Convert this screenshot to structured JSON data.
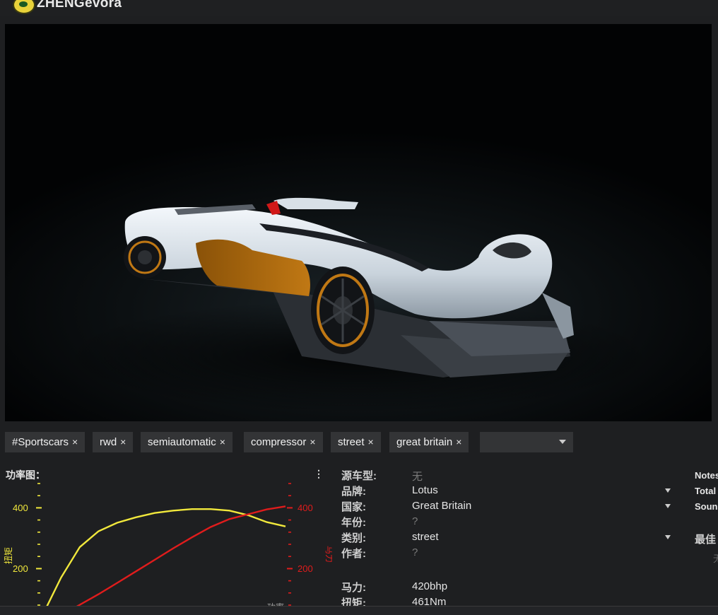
{
  "window": {
    "title": "ZHENGevora",
    "logo_icon": "lotus-logo-icon"
  },
  "tags": [
    {
      "label": "#Sportscars"
    },
    {
      "label": "rwd"
    },
    {
      "label": "semiautomatic"
    },
    {
      "label": "compressor"
    },
    {
      "label": "street"
    },
    {
      "label": "great britain"
    }
  ],
  "tag_remove_symbol": "×",
  "chart": {
    "title": "功率图：",
    "menu_icon": "⋮"
  },
  "chart_data": {
    "type": "line",
    "left_axis": {
      "ticks": [
        "400",
        "200"
      ],
      "color": "#f1e83c"
    },
    "right_axis": {
      "ticks": [
        "400",
        "200"
      ],
      "color": "#e01c1c"
    },
    "series": [
      {
        "color": "#f1e83c",
        "values": [
          45,
          170,
          270,
          322,
          350,
          368,
          382,
          390,
          395,
          395,
          390,
          375,
          352,
          338
        ]
      },
      {
        "color": "#e01c1c",
        "values": [
          10,
          46,
          80,
          115,
          152,
          190,
          228,
          266,
          302,
          336,
          362,
          378,
          394,
          404
        ]
      }
    ],
    "left_label": "扭矩",
    "right_label": "马力",
    "bottom_label": "功率"
  },
  "specs": {
    "rows": [
      {
        "key": "源车型:",
        "value": "无",
        "dim": true
      },
      {
        "key": "品牌:",
        "value": "Lotus",
        "dropdown": true
      },
      {
        "key": "国家:",
        "value": "Great Britain",
        "dropdown": true
      },
      {
        "key": "年份:",
        "value": "?",
        "dim": true
      },
      {
        "key": "类别:",
        "value": "street",
        "dropdown": true
      },
      {
        "key": "作者:",
        "value": "?",
        "dim": true
      },
      {
        "key": "马力:",
        "value": "420bhp"
      },
      {
        "key": "扭矩:",
        "value": "461Nm"
      }
    ]
  },
  "right_panel": {
    "notes": "Notes",
    "total": "Total",
    "sound": "Sound",
    "best": "最佳",
    "faint": "无"
  },
  "colors": {
    "background": "#1e1f21",
    "tag_bg": "#333436",
    "torque": "#f1e83c",
    "power": "#e01c1c"
  }
}
